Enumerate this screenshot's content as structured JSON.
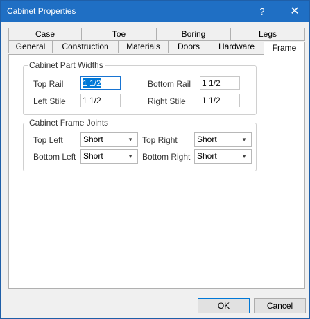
{
  "window": {
    "title": "Cabinet Properties",
    "help_glyph": "?",
    "close_glyph": "✕"
  },
  "tabs": {
    "row1": [
      "Case",
      "Toe",
      "Boring",
      "Legs"
    ],
    "row2": [
      "General",
      "Construction",
      "Materials",
      "Doors",
      "Hardware",
      "Frame"
    ],
    "active": "Frame"
  },
  "widths": {
    "legend": "Cabinet Part Widths",
    "top_rail_label": "Top Rail",
    "top_rail_value": "1 1/2",
    "bottom_rail_label": "Bottom Rail",
    "bottom_rail_value": "1 1/2",
    "left_stile_label": "Left Stile",
    "left_stile_value": "1 1/2",
    "right_stile_label": "Right Stile",
    "right_stile_value": "1 1/2"
  },
  "joints": {
    "legend": "Cabinet Frame Joints",
    "top_left_label": "Top Left",
    "top_left_value": "Short",
    "top_right_label": "Top Right",
    "top_right_value": "Short",
    "bottom_left_label": "Bottom Left",
    "bottom_left_value": "Short",
    "bottom_right_label": "Bottom Right",
    "bottom_right_value": "Short"
  },
  "buttons": {
    "ok": "OK",
    "cancel": "Cancel"
  }
}
